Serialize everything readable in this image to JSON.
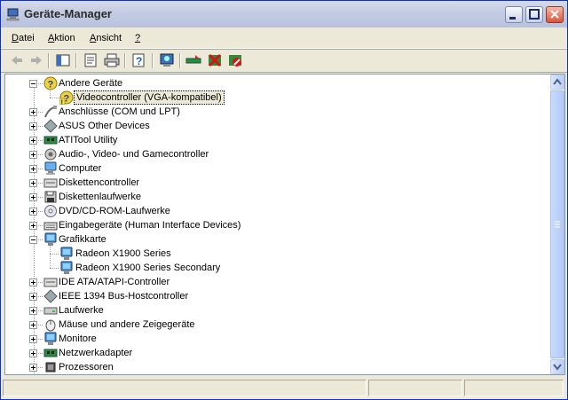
{
  "window": {
    "title": "Geräte-Manager"
  },
  "menu": [
    {
      "label": "Datei",
      "u": "D",
      "rest": "atei"
    },
    {
      "label": "Aktion",
      "u": "A",
      "rest": "ktion"
    },
    {
      "label": "Ansicht",
      "u": "A",
      "rest": "nsicht"
    },
    {
      "label": "?",
      "u": "?",
      "rest": ""
    }
  ],
  "toolbar": [
    "back-arrow-icon",
    "forward-arrow-icon",
    "show-hide-tree-icon",
    "properties-icon",
    "print-icon",
    "help-icon",
    "scan-hardware-icon",
    "update-driver-icon",
    "uninstall-icon",
    "disable-device-icon"
  ],
  "tree": [
    {
      "label": "Andere Geräte",
      "level": 1,
      "expanded": true,
      "icon": "unknown-device-icon"
    },
    {
      "label": "Videocontroller (VGA-kompatibel)",
      "level": 2,
      "selected": true,
      "icon": "warning-device-icon"
    },
    {
      "label": "Anschlüsse (COM und LPT)",
      "level": 1,
      "expanded": false,
      "icon": "port-icon"
    },
    {
      "label": "ASUS Other Devices",
      "level": 1,
      "expanded": false,
      "icon": "diamond-icon"
    },
    {
      "label": "ATITool Utility",
      "level": 1,
      "expanded": false,
      "icon": "chip-board-icon"
    },
    {
      "label": "Audio-, Video- und Gamecontroller",
      "level": 1,
      "expanded": false,
      "icon": "speaker-icon"
    },
    {
      "label": "Computer",
      "level": 1,
      "expanded": false,
      "icon": "computer-icon"
    },
    {
      "label": "Diskettencontroller",
      "level": 1,
      "expanded": false,
      "icon": "controller-icon"
    },
    {
      "label": "Diskettenlaufwerke",
      "level": 1,
      "expanded": false,
      "icon": "floppy-icon"
    },
    {
      "label": "DVD/CD-ROM-Laufwerke",
      "level": 1,
      "expanded": false,
      "icon": "cdrom-icon"
    },
    {
      "label": "Eingabegeräte (Human Interface Devices)",
      "level": 1,
      "expanded": false,
      "icon": "keyboard-icon"
    },
    {
      "label": "Grafikkarte",
      "level": 1,
      "expanded": true,
      "icon": "monitor-icon"
    },
    {
      "label": "Radeon X1900 Series",
      "level": 2,
      "icon": "monitor-icon"
    },
    {
      "label": "Radeon X1900 Series Secondary",
      "level": 2,
      "icon": "monitor-icon"
    },
    {
      "label": "IDE ATA/ATAPI-Controller",
      "level": 1,
      "expanded": false,
      "icon": "controller-icon"
    },
    {
      "label": "IEEE 1394 Bus-Hostcontroller",
      "level": 1,
      "expanded": false,
      "icon": "diamond-icon"
    },
    {
      "label": "Laufwerke",
      "level": 1,
      "expanded": false,
      "icon": "drive-icon"
    },
    {
      "label": "Mäuse und andere Zeigegeräte",
      "level": 1,
      "expanded": false,
      "icon": "mouse-icon"
    },
    {
      "label": "Monitore",
      "level": 1,
      "expanded": false,
      "icon": "monitor-icon"
    },
    {
      "label": "Netzwerkadapter",
      "level": 1,
      "expanded": false,
      "icon": "chip-board-icon"
    },
    {
      "label": "Prozessoren",
      "level": 1,
      "expanded": false,
      "icon": "processor-icon"
    }
  ],
  "colors": {
    "selection": "#ECE9D8",
    "border": "#7f9db9",
    "title_bar": "#c5cde3"
  }
}
